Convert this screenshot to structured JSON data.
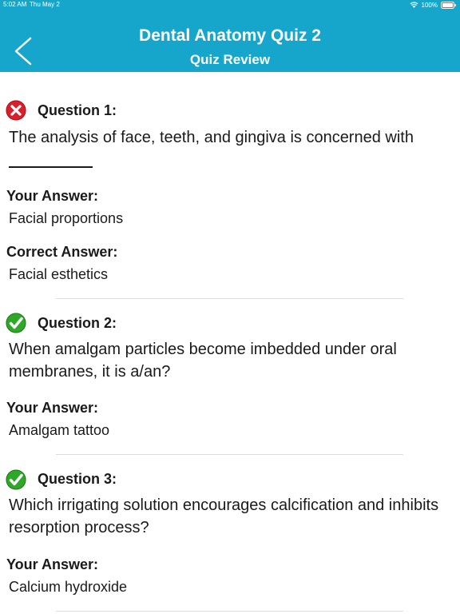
{
  "status_bar": {
    "time": "5:02 AM",
    "date": "Thu May 2",
    "battery": "100%"
  },
  "header": {
    "title": "Dental Anatomy Quiz 2",
    "subtitle": "Quiz Review",
    "background_color": "#17a6cb"
  },
  "questions": [
    {
      "label": "Question 1:",
      "status": "incorrect",
      "icon": "x-mark-icon",
      "text": "The analysis of face, teeth, and gingiva is concerned with",
      "your_answer_label": "Your Answer:",
      "your_answer": "Facial proportions",
      "correct_answer_label": "Correct Answer:",
      "correct_answer": "Facial esthetics"
    },
    {
      "label": "Question 2:",
      "status": "correct",
      "icon": "check-mark-icon",
      "text": "When amalgam particles become imbedded under oral membranes, it is a/an?",
      "your_answer_label": "Your Answer:",
      "your_answer": "Amalgam tattoo"
    },
    {
      "label": "Question 3:",
      "status": "correct",
      "icon": "check-mark-icon",
      "text": "Which irrigating solution encourages calcification and inhibits resorption process?",
      "your_answer_label": "Your Answer:",
      "your_answer": "Calcium hydroxide"
    }
  ],
  "colors": {
    "incorrect": "#d9202a",
    "correct": "#2fa829"
  }
}
